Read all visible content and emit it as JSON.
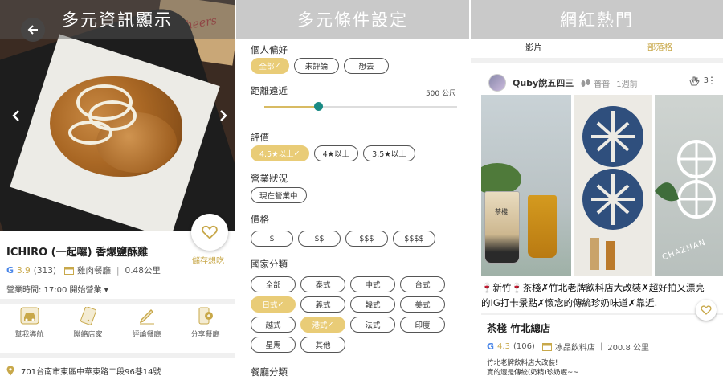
{
  "panels": {
    "info": {
      "banner": "多元資訊顯示",
      "restaurant": {
        "name": "ICHIRO (一起囉) 香爆鹽酥雞",
        "rating": "3.9",
        "review_count": "(313)",
        "category": "雞肉餐廳",
        "distance": "0.48公里",
        "hours": "營業時間: 17:00 開始營業"
      },
      "save_label": "儲存想吃",
      "actions": [
        {
          "label": "幫我導航",
          "icon": "car-icon"
        },
        {
          "label": "聯絡店家",
          "icon": "phone-icon"
        },
        {
          "label": "評論餐廳",
          "icon": "pen-icon"
        },
        {
          "label": "分享餐廳",
          "icon": "share-icon"
        }
      ],
      "address": "701台南市東區中華東路二段96巷14號",
      "photo_text": "Cheers"
    },
    "filters": {
      "banner": "多元條件設定",
      "preference": {
        "title": "個人偏好",
        "options": [
          "全部",
          "未評論",
          "想去"
        ],
        "selected": "全部"
      },
      "distance": {
        "title": "距離遠近",
        "value": "500 公尺",
        "level_percent": 28
      },
      "rating": {
        "title": "評價",
        "options": [
          "4.5★以上",
          "4★以上",
          "3.5★以上"
        ],
        "selected": "4.5★以上"
      },
      "status": {
        "title": "營業狀況",
        "options": [
          "現在營業中"
        ]
      },
      "price": {
        "title": "價格",
        "options": [
          "$",
          "$$",
          "$$$",
          "$$$$"
        ]
      },
      "country": {
        "title": "國家分類",
        "rows": [
          [
            "全部",
            "泰式",
            "中式",
            "台式"
          ],
          [
            "日式",
            "義式",
            "韓式",
            "美式"
          ],
          [
            "越式",
            "港式",
            "法式",
            "印度"
          ],
          [
            "星馬",
            "其他"
          ]
        ],
        "selected": [
          "日式",
          "港式"
        ]
      },
      "meal": {
        "title": "餐廳分類"
      },
      "check_mark": "✓"
    },
    "popular": {
      "banner": "網紅熱門",
      "tabs": [
        "影片",
        "部落格"
      ],
      "active_tab": "部落格",
      "post": {
        "author": "Quby說五四三",
        "level": "普普",
        "time": "1週前",
        "likes": "3",
        "text": "🍷新竹🍷茶棧✗竹北老牌飲料店大改裝✗超好拍又漂亮的IG打卡景點✗懷念的傳統珍奶味道✗靠近.",
        "photo_texts": [
          "茶棧",
          "CHAZHAN"
        ]
      },
      "shop": {
        "name": "茶棧 竹北總店",
        "rating": "4.3",
        "review_count": "(106)",
        "category": "冰品飲料店",
        "distance": "200.8 公里",
        "desc_lines": [
          "竹北老牌飲料店大改裝!",
          "賣的還是傳統(奶精)珍奶喔~~"
        ]
      }
    }
  },
  "colors": {
    "accent": "#e9cc77",
    "gold_text": "#c8a84a",
    "slider_thumb": "#1a8a84",
    "banner_gray": "#c9c9c9"
  }
}
